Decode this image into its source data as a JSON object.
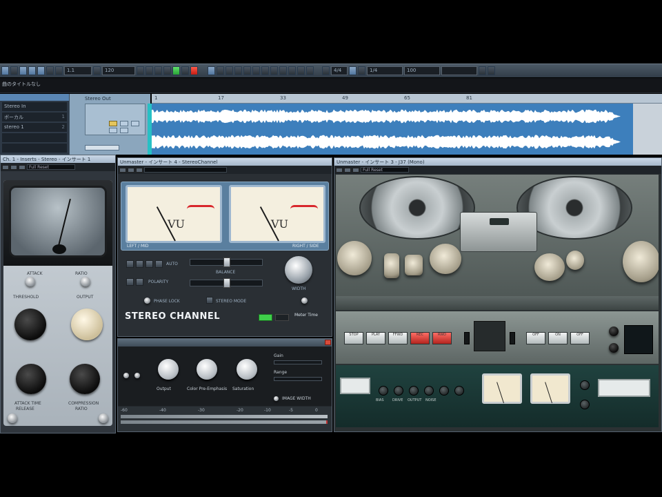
{
  "toolbar": {
    "position_value": "1.1",
    "tempo_field": "120",
    "time_sig": "4/4",
    "zoom_value": "100",
    "snap_value": "1/4"
  },
  "info_line": "曲のタイトルなし",
  "tracks": [
    {
      "name": "Stereo In",
      "num": ""
    },
    {
      "name": "ボーカル",
      "num": "1"
    },
    {
      "name": "stereo 1",
      "num": "2"
    },
    {
      "name": "",
      "num": ""
    },
    {
      "name": "",
      "num": ""
    }
  ],
  "inspector_label": "Stereo Out",
  "ruler": [
    "1",
    "17",
    "33",
    "49",
    "65",
    "81"
  ],
  "left_plugin": {
    "title": "Ch. 1 - Inserts - Stereo - インサート 1",
    "preset": "Full Reset",
    "labels": {
      "attack": "ATTACK",
      "ratio": "RATIO",
      "threshold": "THRESHOLD",
      "output": "OUTPUT",
      "attack_time": "ATTACK TIME",
      "release": "RELEASE",
      "compression": "COMPRESSION",
      "ratio2": "RATIO"
    }
  },
  "stereo_channel": {
    "title": "Unmaster - インサート 4 - StereoChannel",
    "name": "STEREO CHANNEL",
    "left_vu": "LEFT / MID",
    "right_vu": "RIGHT / SIDE",
    "auto": "AUTO",
    "polarity": "POLARITY",
    "balance": "BALANCE",
    "width": "WIDTH",
    "phasing": "PHASE LOCK",
    "stereo_mode": "STEREO MODE",
    "vu_label": "VU",
    "meter_mode": "Meter Time",
    "logo": "Stereo Time"
  },
  "bottom_plugin": {
    "knob_labels": [
      "Output",
      "Color Pre-Emphasis",
      "Saturation"
    ],
    "labels": [
      "Gain",
      "Range",
      "IMAGE WIDTH"
    ],
    "scale": [
      "-60",
      "-40",
      "-30",
      "-20",
      "-10",
      "-5",
      "0"
    ]
  },
  "tape": {
    "title": "Unmaster - インサート 3 - J37 (Mono)",
    "preset": "Full Reset",
    "transport": [
      "STOP",
      "PLAY",
      "FFWD",
      "REC",
      "RWD"
    ],
    "right_btns": [
      "OFF",
      "ON",
      "OFF"
    ],
    "bottom_labels": [
      "BIAS",
      "DRIVE",
      "OUTPUT",
      "NOISE"
    ],
    "colors": {
      "body": "#5e6664",
      "panel": "#1b3836"
    }
  }
}
